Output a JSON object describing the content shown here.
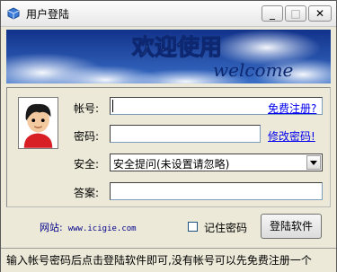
{
  "window": {
    "title": "用户登陆",
    "minimize_glyph": "_",
    "maximize_glyph": "□",
    "close_glyph": "✕"
  },
  "banner": {
    "heading": "欢迎使用",
    "subheading": "welcome"
  },
  "form": {
    "account_label": "帐号:",
    "password_label": "密码:",
    "security_label": "安全:",
    "answer_label": "答案:",
    "account_value": "",
    "password_value": "",
    "answer_value": "",
    "security_selected": "安全提问(未设置请忽略)",
    "register_link": "免费注册?",
    "change_password_link": "修改密码!"
  },
  "bottom": {
    "website_label": "网站:",
    "website_url": "www.icigie.com",
    "remember_label": "记住密码",
    "remember_checked": false,
    "login_button": "登陆软件"
  },
  "status": {
    "text": "输入帐号密码后点击登陆软件即可,没有帐号可以先免费注册一个"
  },
  "icons": [
    "app-icon",
    "avatar-icon",
    "chevron-down-icon"
  ],
  "colors": {
    "banner_sky": "#1e4aa0",
    "link": "#0000ee",
    "website": "#00008b"
  }
}
